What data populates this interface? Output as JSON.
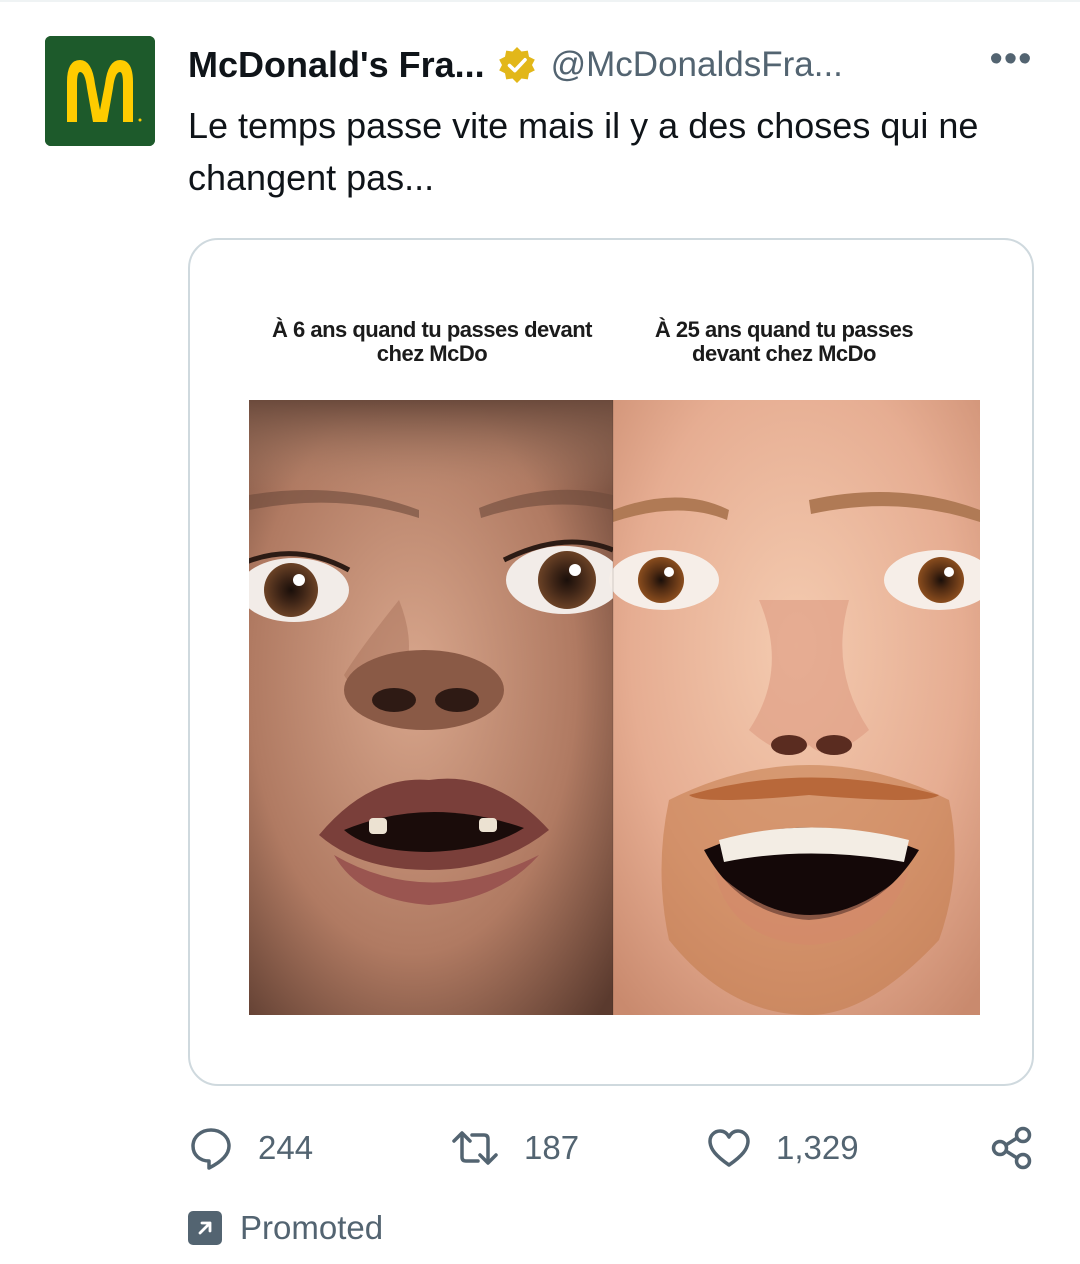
{
  "tweet": {
    "author_name": "McDonald's Fra...",
    "handle": "@McDonaldsFra...",
    "more_label": "•••",
    "text": "Le temps passe vite mais il y a des choses qui ne changent pas...",
    "avatar_icon": "mcdonalds-logo-icon",
    "verified_icon": "verified-gold-badge-icon"
  },
  "media": {
    "caption_left": "À 6 ans quand tu passes devant chez McDo",
    "caption_right": "À 25 ans quand tu passes devant chez McDo"
  },
  "actions": {
    "replies": "244",
    "retweets": "187",
    "likes": "1,329"
  },
  "promoted_label": "Promoted",
  "colors": {
    "muted": "#536471",
    "text": "#0f1419",
    "border": "#cfd9de",
    "brand_green": "#1d5a2b",
    "brand_yellow": "#ffcc00",
    "verified_gold": "#e2b719"
  }
}
